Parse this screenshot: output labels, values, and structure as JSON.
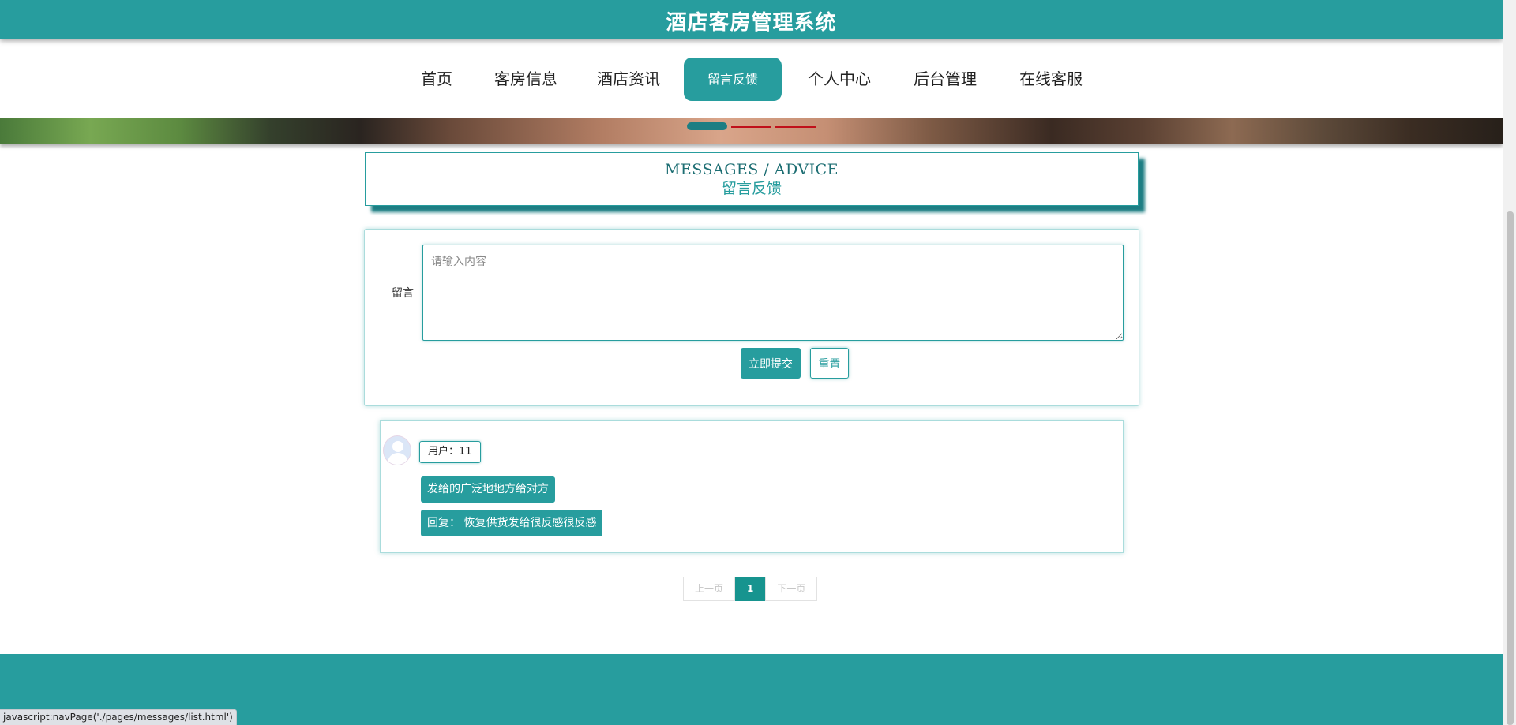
{
  "header": {
    "title": "酒店客房管理系统"
  },
  "nav": {
    "items": [
      {
        "label": "首页"
      },
      {
        "label": "客房信息"
      },
      {
        "label": "酒店资讯"
      },
      {
        "label": "留言反馈",
        "active": true
      },
      {
        "label": "个人中心"
      },
      {
        "label": "后台管理"
      },
      {
        "label": "在线客服"
      }
    ]
  },
  "section": {
    "title_en": "MESSAGES / ADVICE",
    "title_cn": "留言反馈"
  },
  "form": {
    "label": "留言",
    "placeholder": "请输入内容",
    "value": "",
    "submit_label": "立即提交",
    "reset_label": "重置"
  },
  "messages": [
    {
      "user": "用户：11",
      "content": "发给的广泛地地方给对方",
      "reply": "回复： 恢复供货发给很反感很反感"
    }
  ],
  "pagination": {
    "prev_label": "上一页",
    "current_page": "1",
    "next_label": "下一页"
  },
  "status_bar": {
    "text": "javascript:navPage('./pages/messages/list.html')"
  },
  "colors": {
    "primary": "#279d9e",
    "primary_dark": "#1d7e83",
    "pager_active": "#17948f"
  }
}
